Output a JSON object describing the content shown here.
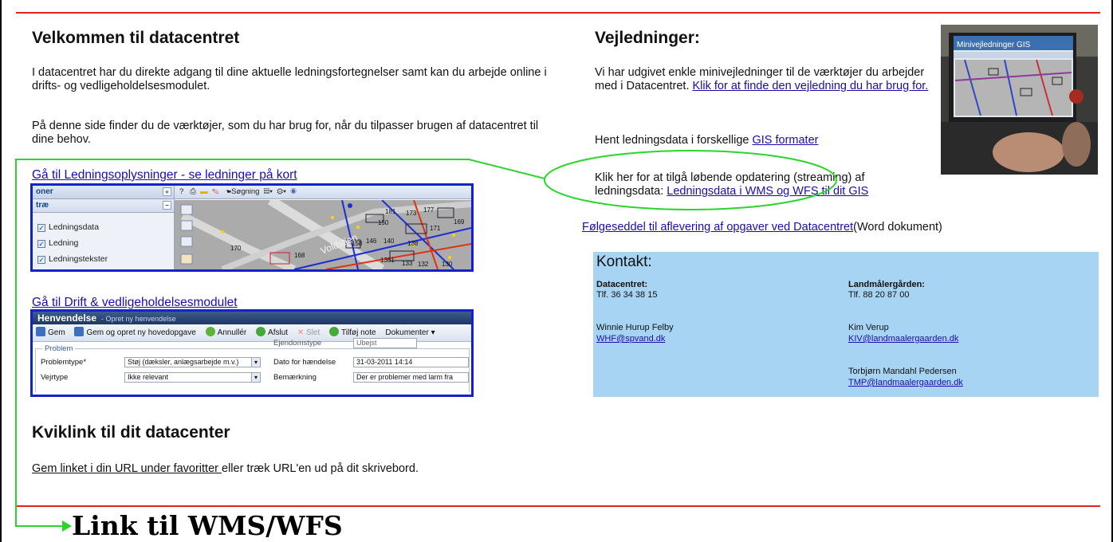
{
  "welcome": {
    "heading": "Velkommen til datacentret",
    "intro": "I datacentret har du direkte adgang til dine aktuelle ledningsfortegnelser samt kan du arbejde online i drifts- og vedligeholdelsesmodulet.",
    "tools_text": "På denne side finder du de værktøjer, som du har brug for, når du tilpasser brugen af datacentret til dine behov."
  },
  "ledning_link": "Gå til Ledningsoplysninger - se ledninger på kort",
  "map_screenshot": {
    "panel_header_1": "oner",
    "panel_header_2": "træ",
    "layers": [
      "Ledningsdata",
      "Ledning",
      "Ledningstekster"
    ],
    "toolbar_label": "Søgning",
    "street_label": "Voldstien",
    "numbers": [
      "181",
      "173",
      "177",
      "150",
      "171",
      "169",
      "146",
      "140",
      "138",
      "158",
      "170",
      "168",
      "1361",
      "133",
      "132",
      "130"
    ]
  },
  "drift_link": "Gå til Drift & vedligeholdelsesmodulet",
  "form_screenshot": {
    "title": "Henvendelse",
    "subtitle": "- Opret ny henvendelse",
    "toolbar": {
      "gem": "Gem",
      "gem_hoved": "Gem og opret ny hovedopgave",
      "annuller": "Annullér",
      "afslut": "Afslut",
      "slet": "Slet",
      "tilfoej": "Tilføj note",
      "dokumenter": "Dokumenter"
    },
    "group_label": "Problem",
    "partial_label": "Ejendomstype",
    "partial_value": "Ubejst",
    "fields": {
      "problemtype_label": "Problemtype*",
      "problemtype_value": "Støj (dæksler, anlægsarbejde m.v.)",
      "dato_label": "Dato for hændelse",
      "dato_value": "31-03-2011 14:14",
      "vejrtype_label": "Vejrtype",
      "vejrtype_value": "Ikke relevant",
      "bemaerkning_label": "Bemærkning",
      "bemaerkning_value": "Der er problemer med larm fra"
    }
  },
  "kviklink": {
    "heading": "Kviklink til dit datacenter",
    "link": "Gem linket i din URL under favoritter ",
    "rest": "eller træk URL'en ud på dit skrivebord."
  },
  "vejledninger": {
    "heading": "Vejledninger:",
    "text": "Vi har udgivet enkle minivejledninger til de værktøjer du arbejder med i Datacentret. ",
    "link": "Klik for at finde den vejledning du har brug for.",
    "photo_caption": "Minivejledninger GIS"
  },
  "gis": {
    "text": "Hent ledningsdata i forskellige ",
    "link": "GIS formater"
  },
  "streaming": {
    "text": "Klik her for at tilgå løbende opdatering (streaming) af ledningsdata: ",
    "link": "Ledningsdata i WMS og WFS til dit GIS"
  },
  "foelgeseddel": {
    "link": "Følgeseddel til aflevering af opgaver ved Datacentret",
    "suffix": "(Word dokument)"
  },
  "contact": {
    "title": "Kontakt:",
    "left": {
      "org": "Datacentret:",
      "phone": "Tlf. 36 34 38 15",
      "person": "Winnie Hurup Felby",
      "email": "WHF@spvand.dk"
    },
    "right": {
      "org": "Landmålergården:",
      "phone": "Tlf. 88 20 87 00",
      "person1": "Kim Verup",
      "email1": "KIV@landmaalergaarden.dk",
      "person2": "Torbjørn Mandahl Pedersen",
      "email2": "TMP@landmaalergaarden.dk"
    }
  },
  "annotation": {
    "title": "Link til WMS/WFS"
  },
  "colors": {
    "rule": "#e2231a",
    "callout": "#2ad62a",
    "highlight_box": "#1423c8",
    "contact_bg": "#a8d4f3"
  }
}
